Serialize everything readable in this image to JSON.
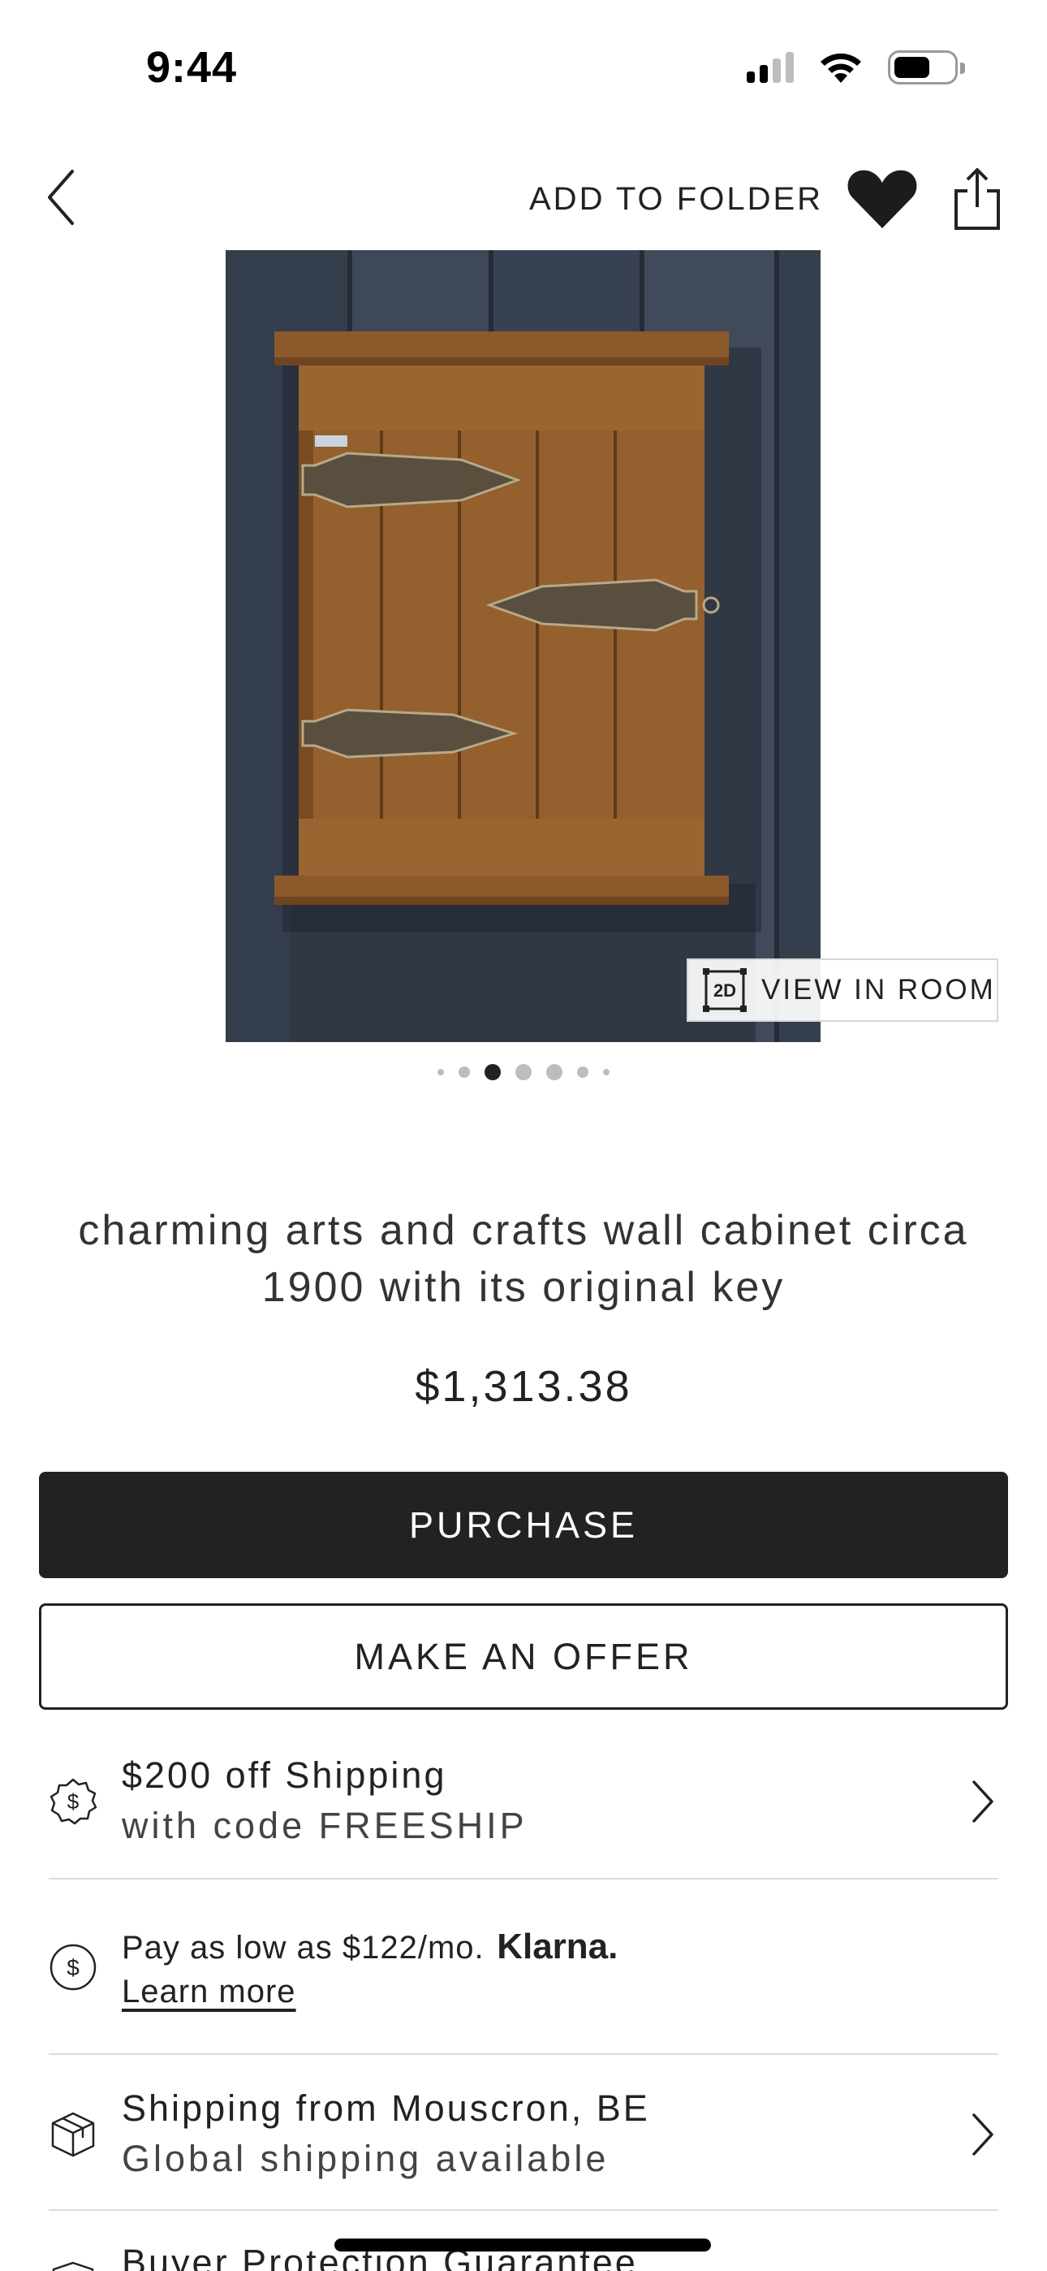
{
  "status_bar": {
    "time": "9:44",
    "icons": [
      "cellular-signal-icon",
      "wifi-icon",
      "battery-icon"
    ]
  },
  "nav": {
    "back_icon": "chevron-left-icon",
    "add_to_folder_label": "ADD TO FOLDER",
    "favorite_icon": "heart-icon",
    "favorite_state": "filled",
    "share_icon": "share-icon"
  },
  "gallery": {
    "image_alt": "oak wall cabinet with brass hinges on dark wooden planks",
    "view_in_room_badge": "2D",
    "view_in_room_label": "VIEW IN ROOM",
    "dots_total": 7,
    "active_dot": 2
  },
  "listing": {
    "title": "charming arts and crafts wall cabinet circa 1900 with its original key",
    "price": "$1,313.38"
  },
  "actions": {
    "purchase_label": "PURCHASE",
    "offer_label": "MAKE AN OFFER"
  },
  "shipping_promo": {
    "icon": "dollar-badge-icon",
    "title": "$200 off Shipping",
    "subtitle": "with code FREESHIP"
  },
  "financing": {
    "icon": "dollar-circle-icon",
    "text": "Pay as low as $122/mo.",
    "brand": "Klarna.",
    "link": "Learn more"
  },
  "shipping_origin": {
    "icon": "package-box-icon",
    "title": "Shipping from Mouscron, BE",
    "subtitle": "Global shipping available"
  },
  "buyer_protection": {
    "icon": "shield-icon",
    "title": "Buyer Protection Guarantee"
  },
  "colors": {
    "primary_button": "#222222",
    "text": "#222222",
    "divider": "#dcdcdc"
  }
}
